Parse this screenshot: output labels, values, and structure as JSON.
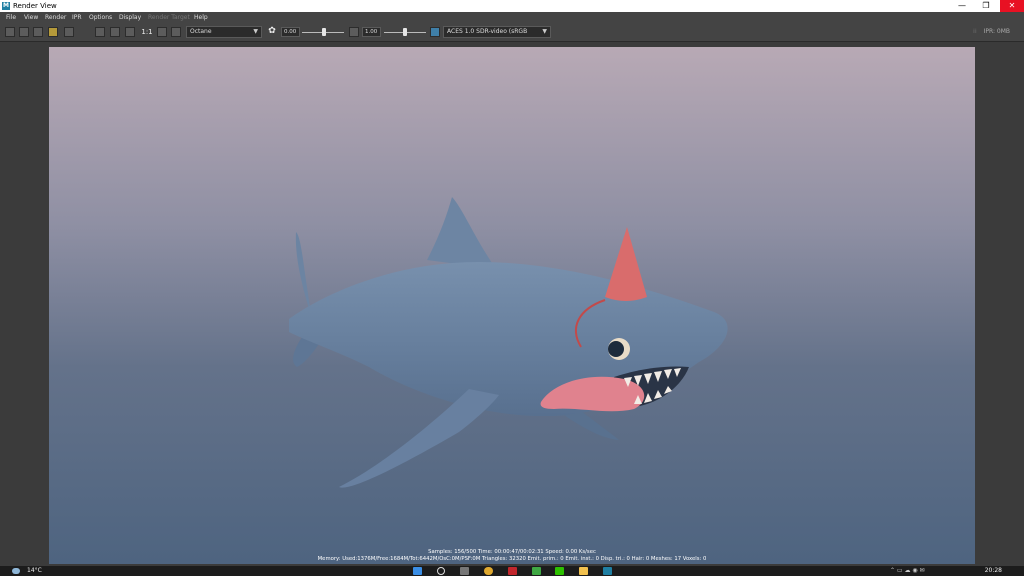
{
  "window": {
    "title": "Render View",
    "app_icon": "M",
    "controls": [
      "—",
      "❐",
      "✕"
    ]
  },
  "menu": [
    {
      "label": "File",
      "enabled": true
    },
    {
      "label": "View",
      "enabled": true
    },
    {
      "label": "Render",
      "enabled": true
    },
    {
      "label": "IPR",
      "enabled": true
    },
    {
      "label": "Options",
      "enabled": true
    },
    {
      "label": "Display",
      "enabled": true
    },
    {
      "label": "Render Target",
      "enabled": false
    },
    {
      "label": "Help",
      "enabled": true
    }
  ],
  "toolbar": {
    "ratio_label": "1:1",
    "renderer": "Octane",
    "exposure_value": "0.00",
    "gamma_value": "1.00",
    "color_transform": "ACES 1.0 SDR-video (sRGB",
    "ipr_status": "IPR: 0MB",
    "icons": [
      "render-frame-icon",
      "render-region-icon",
      "snapshot-icon",
      "ipr-icon",
      "render-settings-icon",
      "keep-image-icon",
      "remove-image-icon",
      "refresh-icon",
      "ratio-icon",
      "display-rgb-icon",
      "display-alpha-icon",
      "exposure-icon",
      "gamma-icon",
      "color-management-icon"
    ]
  },
  "render": {
    "subject": "shark-with-party-hat",
    "colors": {
      "shark_body": "#6a819e",
      "hat": "#d96c6c",
      "tongue": "#e0828e",
      "strap": "#c24a4a",
      "teeth": "#f2ece6",
      "eye": "#1d2b3c"
    },
    "stats_line1": "Samples: 156/500 Time: 00:00:47/00:02:31  Speed: 0.00 Ks/sec",
    "stats_line2": "Memory: Used:1376M/Free:1684M/Tot:6442M/OsC:0M/PSF:0M Triangles: 32320 Emit. prim.: 0 Emit. inst.: 0 Disp. tri.: 0 Hair: 0 Meshes: 17 Voxels: 0"
  },
  "taskbar": {
    "weather": "14°C",
    "clock": "20:28",
    "apps": [
      "start-icon",
      "search-icon",
      "task-view-icon",
      "chrome-icon",
      "app-red-icon",
      "xbox-icon",
      "wechat-icon",
      "file-explorer-icon",
      "maya-icon"
    ]
  }
}
